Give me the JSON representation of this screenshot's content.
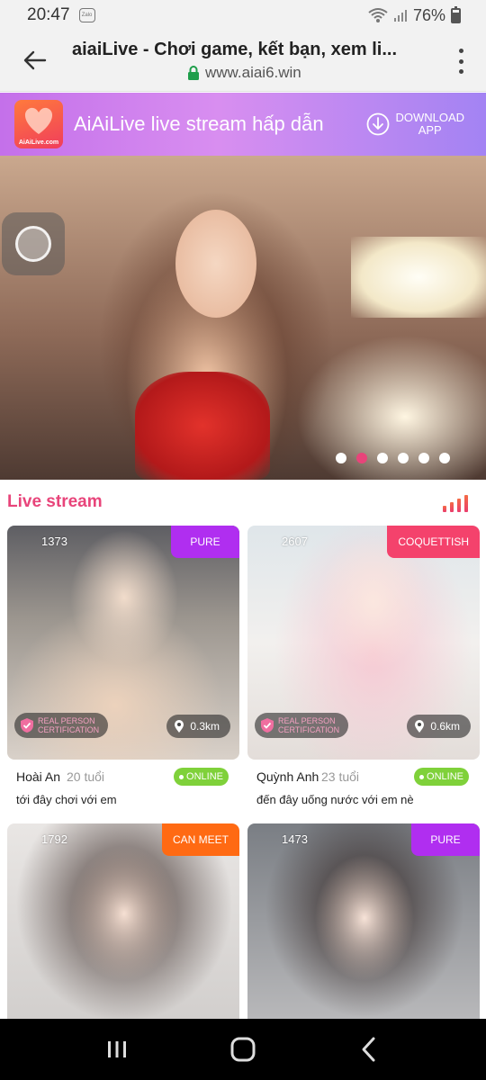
{
  "status_bar": {
    "time": "20:47",
    "notification_icon": "zalo-icon",
    "notification_text": "Zalo",
    "battery": "76%"
  },
  "browser": {
    "title": "aiaiLive - Chơi game, kết bạn, xem li...",
    "url": "www.aiai6.win"
  },
  "banner": {
    "text": "AiAiLive live stream hấp dẫn",
    "logo_label": "AiAiLive.com",
    "download_label_line1": "DOWNLOAD",
    "download_label_line2": "APP"
  },
  "carousel": {
    "dot_count": 6,
    "active_index": 1
  },
  "section": {
    "title": "Live stream"
  },
  "cards": [
    {
      "viewers": "1373",
      "tag": "PURE",
      "tag_color": "#b02ef0",
      "cert_line1": "REAL PERSON",
      "cert_line2": "CERTIFICATION",
      "distance": "0.3km",
      "name": "Hoài An",
      "age": "20 tuổi",
      "status": "ONLINE",
      "caption": "tới đây chơi với em"
    },
    {
      "viewers": "2607",
      "tag": "COQUETTISH",
      "tag_color": "#f4426c",
      "cert_line1": "REAL PERSON",
      "cert_line2": "CERTIFICATION",
      "distance": "0.6km",
      "name": "Quỳnh Anh",
      "age": "23 tuổi",
      "status": "ONLINE",
      "caption": "đến đây uống nước với em nè"
    },
    {
      "viewers": "1792",
      "tag": "CAN MEET",
      "tag_color": "#ff6a13"
    },
    {
      "viewers": "1473",
      "tag": "PURE",
      "tag_color": "#b02ef0"
    }
  ],
  "colors": {
    "accent": "#e8447a",
    "online": "#7fd13a"
  }
}
